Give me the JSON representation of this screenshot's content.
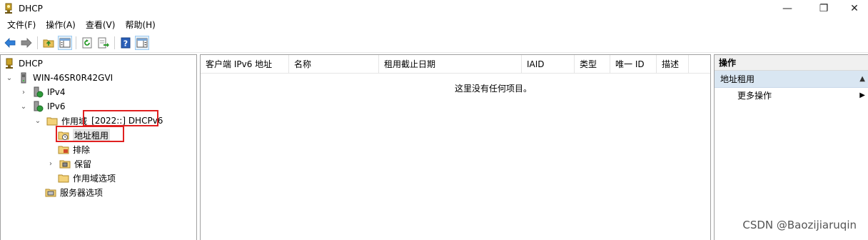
{
  "window": {
    "title": "DHCP",
    "minimize_glyph": "—",
    "restore_glyph": "❐",
    "close_glyph": "✕"
  },
  "menu": [
    "文件(F)",
    "操作(A)",
    "查看(V)",
    "帮助(H)"
  ],
  "toolbar": {
    "icons": [
      "back-arrow-icon",
      "forward-arrow-icon",
      "up-folder-icon",
      "show-hide-tree-icon",
      "refresh-icon",
      "export-list-icon",
      "help-icon",
      "show-hide-action-pane-icon"
    ]
  },
  "tree": {
    "root": "DHCP",
    "server": "WIN-46SR0R42GVI",
    "ipv4": "IPv4",
    "ipv6": "IPv6",
    "scope_prefix": "作用域",
    "scope_name": "[2022::] DHCPv6",
    "leases": "地址租用",
    "exclusions": "排除",
    "reservations": "保留",
    "scope_options": "作用域选项",
    "server_options": "服务器选项"
  },
  "list": {
    "columns": [
      "客户端 IPv6 地址",
      "名称",
      "租用截止日期",
      "IAID",
      "类型",
      "唯一 ID",
      "描述"
    ],
    "empty_message": "这里没有任何项目。"
  },
  "actions": {
    "header": "操作",
    "section": "地址租用",
    "items": [
      "更多操作"
    ]
  },
  "colors": {
    "annotation_red": "#e02020",
    "action_section_bg": "#d9e6f2",
    "pane_border": "#a0a0a0"
  },
  "watermark": "CSDN @Baozijiaruqin"
}
